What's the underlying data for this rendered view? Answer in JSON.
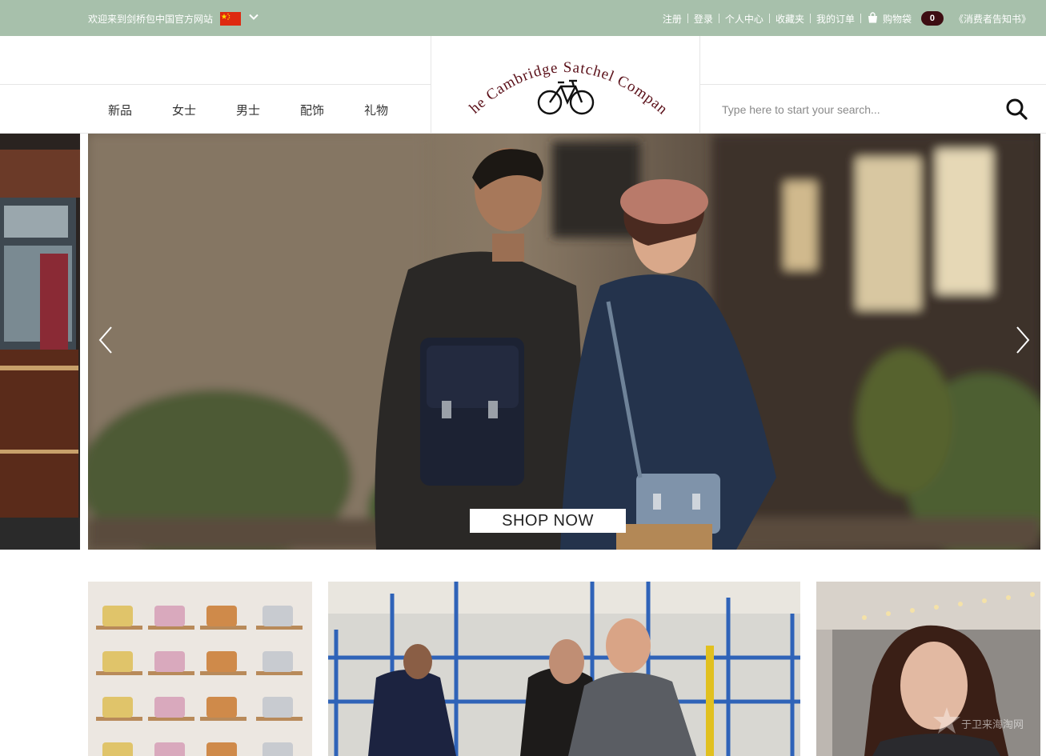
{
  "topbar": {
    "welcome": "欢迎来到剑桥包中国官方网站",
    "links": {
      "register": "注册",
      "login": "登录",
      "account": "个人中心",
      "favorites": "收藏夹",
      "orders": "我的订单",
      "bag": "购物袋",
      "bag_count": "0",
      "notice": "《消费者告知书》"
    }
  },
  "header": {
    "logo_text": "The Cambridge Satchel Company",
    "nav": [
      "新品",
      "女士",
      "男士",
      "配饰",
      "礼物"
    ],
    "search_placeholder": "Type here to start your search..."
  },
  "hero": {
    "cta": "SHOP NOW"
  },
  "watermark": "于卫来海淘网",
  "colors": {
    "topbar": "#a7c0ab",
    "logo_text": "#5a0f18",
    "badge": "#3d0d12"
  },
  "icons": [
    "china-flag-icon",
    "chevron-down-icon",
    "shopping-bag-icon",
    "bicycle-icon",
    "search-icon",
    "chevron-left-icon",
    "chevron-right-icon"
  ]
}
